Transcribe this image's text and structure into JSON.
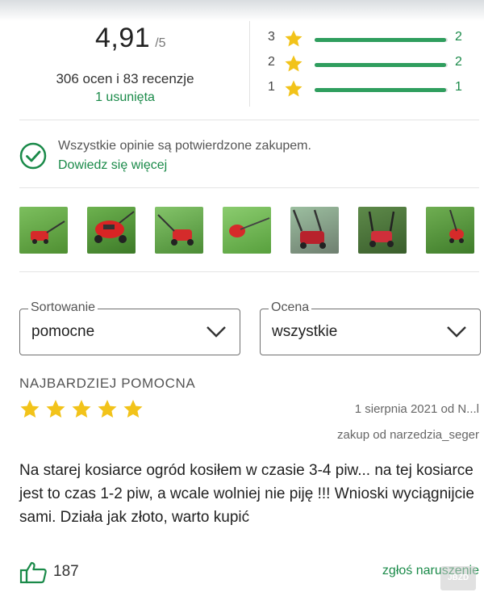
{
  "rating": {
    "score": "4,91",
    "max": "/5",
    "counts_text": "306 ocen i 83 recenzje",
    "removed_text": "1 usunięta",
    "bars": [
      {
        "level": "3",
        "count": "2",
        "fraction": 0.99
      },
      {
        "level": "2",
        "count": "2",
        "fraction": 0.99
      },
      {
        "level": "1",
        "count": "1",
        "fraction": 0.99
      }
    ]
  },
  "verified": {
    "text": "Wszystkie opinie są potwierdzone zakupem.",
    "link": "Dowiedz się więcej"
  },
  "photos": [
    {
      "name": "lawnmower-photo-1"
    },
    {
      "name": "lawnmower-photo-2"
    },
    {
      "name": "lawnmower-photo-3"
    },
    {
      "name": "lawnmower-photo-4"
    },
    {
      "name": "lawnmower-photo-5"
    },
    {
      "name": "lawnmower-photo-6"
    },
    {
      "name": "lawnmower-photo-7"
    }
  ],
  "filters": {
    "sort": {
      "label": "Sortowanie",
      "value": "pomocne"
    },
    "rating": {
      "label": "Ocena",
      "value": "wszystkie"
    }
  },
  "review": {
    "section_title": "NAJBARDZIEJ POMOCNA",
    "stars": 5,
    "meta": "1 sierpnia 2021 od N...l",
    "source": "zakup od narzedzia_seger",
    "body": "Na starej kosiarce ogród kosiłem w czasie 3-4 piw... na tej kosiarce jest to czas 1-2 piw, a wcale wolniej nie piję !!! Wnioski wyciągnijcie sami. Działa jak złoto, warto kupić",
    "helpful_count": "187",
    "report_label": "zgłoś naruszenie"
  },
  "watermark": "JBZD",
  "colors": {
    "accent_green": "#1a8a49",
    "star_yellow": "#f2c31a",
    "bar_fill": "#2f9e5e"
  },
  "icons": {
    "check": "check-circle-icon",
    "thumb": "thumbs-up-icon",
    "chevron": "chevron-down-icon",
    "star": "star-icon"
  }
}
